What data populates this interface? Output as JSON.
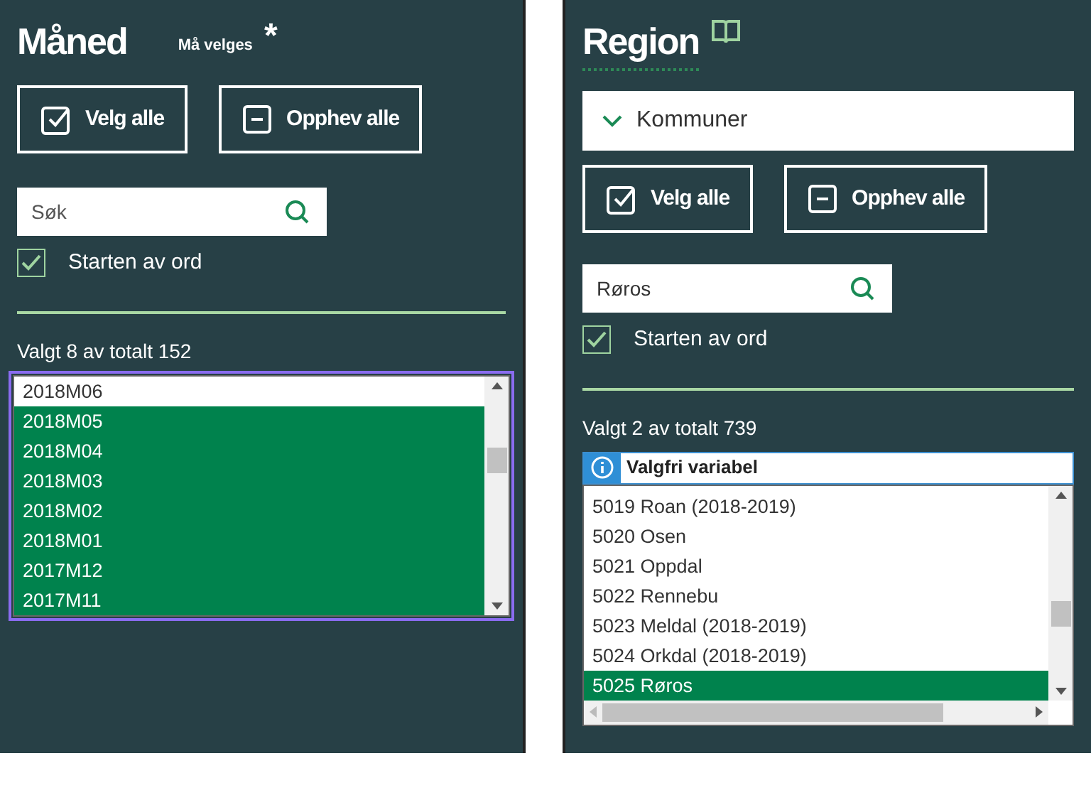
{
  "panels": [
    {
      "title": "Måned",
      "required_note": "Må velges",
      "required_mark": "*",
      "has_info_icon": false,
      "buttons": [
        {
          "kind": "select",
          "label": "Velg alle"
        },
        {
          "kind": "deselect",
          "label": "Opphev alle"
        }
      ],
      "search": {
        "placeholder": "Søk"
      },
      "word_start": {
        "label": "Starten av ord",
        "checked": true
      },
      "count": "Valgt 8 av totalt 152",
      "focused": true,
      "horizontal_scroll": false,
      "items": [
        {
          "label": "2018M06",
          "selected": false
        },
        {
          "label": "2018M05",
          "selected": true
        },
        {
          "label": "2018M04",
          "selected": true
        },
        {
          "label": "2018M03",
          "selected": true
        },
        {
          "label": "2018M02",
          "selected": true
        },
        {
          "label": "2018M01",
          "selected": true
        },
        {
          "label": "2017M12",
          "selected": true
        },
        {
          "label": "2017M11",
          "selected": true
        }
      ]
    },
    {
      "title": "Region",
      "has_info_icon": true,
      "dropdown": {
        "label": "Kommuner",
        "expanded": true
      },
      "buttons": [
        {
          "kind": "select",
          "label": "Velg alle"
        },
        {
          "kind": "deselect",
          "label": "Opphev alle"
        }
      ],
      "search": {
        "value": "Røros"
      },
      "word_start": {
        "label": "Starten av ord",
        "checked": true
      },
      "count": "Valgt 2 av totalt 739",
      "banner": "Valgfri variabel",
      "focused": false,
      "horizontal_scroll": true,
      "items": [
        {
          "label": "5019 Roan (2018-2019)",
          "selected": false
        },
        {
          "label": "5020 Osen",
          "selected": false
        },
        {
          "label": "5021 Oppdal",
          "selected": false
        },
        {
          "label": "5022 Rennebu",
          "selected": false
        },
        {
          "label": "5023 Meldal (2018-2019)",
          "selected": false
        },
        {
          "label": "5024 Orkdal (2018-2019)",
          "selected": false
        },
        {
          "label": "5025 Røros",
          "selected": true
        }
      ]
    }
  ]
}
